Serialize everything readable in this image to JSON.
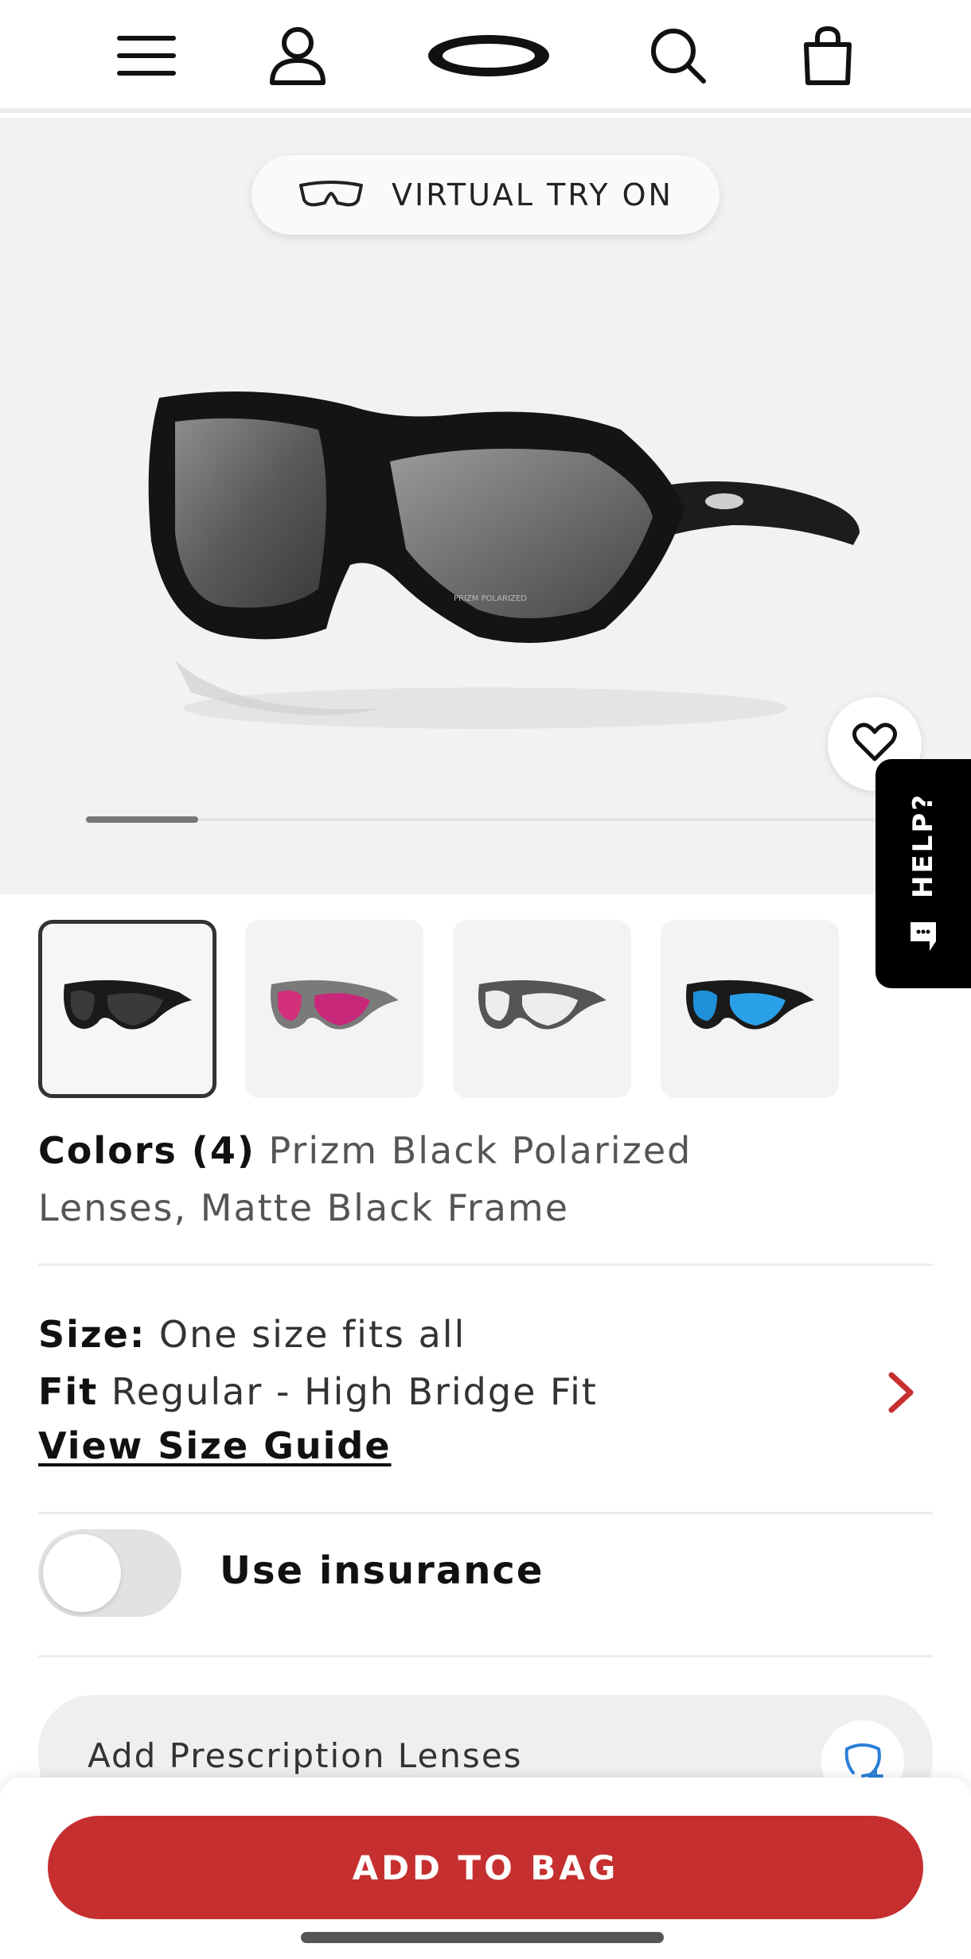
{
  "header": {
    "icons": [
      "menu-icon",
      "account-icon",
      "brand-logo",
      "search-icon",
      "bag-icon"
    ]
  },
  "hero": {
    "try_on_label": "VIRTUAL TRY ON",
    "gallery_progress_fraction": 0.14,
    "help_label": "HELP?"
  },
  "colors": {
    "count_label": "Colors (4)",
    "selected_name": "Prizm Black Polarized Lenses, Matte Black Frame",
    "swatches": [
      {
        "lens": "#3a3a3a",
        "frame": "#1a1a1a",
        "selected": true
      },
      {
        "lens": "#d2307a",
        "frame": "#6a6a6a",
        "selected": false
      },
      {
        "lens": "#e8e8e8",
        "frame": "#555555",
        "selected": false
      },
      {
        "lens": "#1f8fd8",
        "frame": "#1a1a1a",
        "selected": false
      }
    ]
  },
  "size": {
    "size_label": "Size:",
    "size_value": "One size fits all",
    "fit_label": "Fit",
    "fit_value": "Regular - High Bridge Fit",
    "guide_link": "View Size Guide"
  },
  "insurance": {
    "label": "Use insurance",
    "enabled": false
  },
  "prescription": {
    "label": "Add Prescription Lenses"
  },
  "cta": {
    "add_to_bag": "ADD TO BAG"
  },
  "colors_theme": {
    "accent": "#c62f2f",
    "hero_bg": "#f2f2f2"
  }
}
